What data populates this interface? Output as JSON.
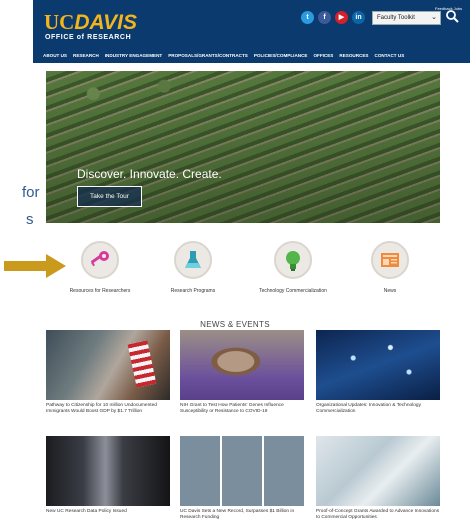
{
  "annotation": {
    "line1": "for",
    "line2": "s"
  },
  "header": {
    "logo_uc": "UC",
    "logo_davis": "DAVIS",
    "logo_sub": "OFFICE of RESEARCH",
    "faculty_link": "Feedback Jobs",
    "toolkit_select": "Faculty Toolkit",
    "social": [
      "twitter-icon",
      "facebook-icon",
      "youtube-icon",
      "linkedin-icon"
    ]
  },
  "nav": [
    "ABOUT US",
    "RESEARCH",
    "INDUSTRY ENGAGEMENT",
    "PROPOSALS/GRANTS/CONTRACTS",
    "POLICIES/COMPLIANCE",
    "OFFICES",
    "RESOURCES",
    "CONTACT US"
  ],
  "hero": {
    "title": "Discover. Innovate. Create.",
    "button": "Take the Tour"
  },
  "tiles": [
    {
      "label": "Resources for Researchers",
      "icon": "key-icon"
    },
    {
      "label": "Research Programs",
      "icon": "flask-icon"
    },
    {
      "label": "Technology Commercialization",
      "icon": "lightbulb-icon"
    },
    {
      "label": "News",
      "icon": "newspaper-icon"
    }
  ],
  "news": {
    "heading": "NEWS & EVENTS",
    "items": [
      {
        "caption": "Pathway to Citizenship for 10 million Undocumented Immigrants Would Boost GDP by $1.7 Trillion"
      },
      {
        "caption": "NIH Grant to Test How Patients' Genes Influence Susceptibility or Resistance to COVID-19"
      },
      {
        "caption": "Organizational Updates: Innovation & Technology Commercialization"
      },
      {
        "caption": "New UC Research Data Policy Issued"
      },
      {
        "caption": "UC Davis Sets a New Record, Surpasses $1 Billion in Research Funding"
      },
      {
        "caption": "Proof-of-Concept Grants Awarded to Advance Innovations to Commercial Opportunities"
      }
    ]
  },
  "colors": {
    "navy": "#0b3a6e",
    "gold": "#f2b51c",
    "arrow": "#c99a1c"
  }
}
